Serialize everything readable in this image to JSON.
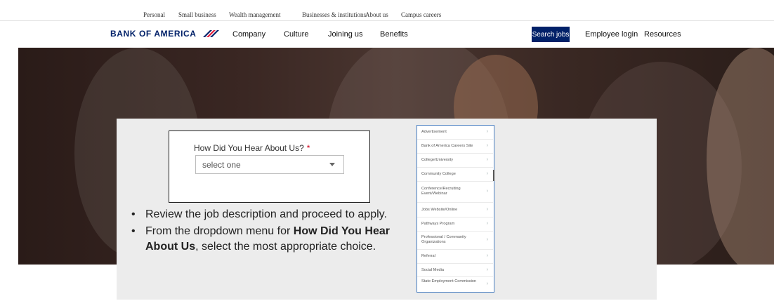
{
  "utility_nav": {
    "items": [
      "Personal",
      "Small business",
      "Wealth management",
      "Businesses & institutions",
      "About us",
      "Campus careers"
    ]
  },
  "main_nav": {
    "logo_text": "BANK OF AMERICA",
    "links": [
      "Company",
      "Culture",
      "Joining us",
      "Benefits"
    ],
    "search_button": "Search jobs",
    "employee_login": "Employee login",
    "resources": "Resources"
  },
  "form": {
    "label": "How Did You Hear About Us?",
    "required_mark": "*",
    "select_value": "select one"
  },
  "instructions": {
    "item1": "Review the job description and proceed to apply.",
    "item2_prefix": "From the dropdown menu for ",
    "item2_bold": "How Did You Hear About Us",
    "item2_suffix": ", select the most appropriate choice."
  },
  "dropdown": {
    "options": [
      "Advertisement",
      "Bank of America Careers Site",
      "College/University",
      "Community College",
      "Conference/Recruiting Event/Webinar",
      "Jobs Website/Online",
      "Pathways Program",
      "Professional / Community Organizations",
      "Referral",
      "Social Media",
      "State Employment Commission"
    ],
    "chevron": "›"
  },
  "colors": {
    "brand_navy": "#012169",
    "brand_red": "#e31837",
    "required_red": "#d0021b",
    "dropdown_border": "#4a7fc1"
  }
}
